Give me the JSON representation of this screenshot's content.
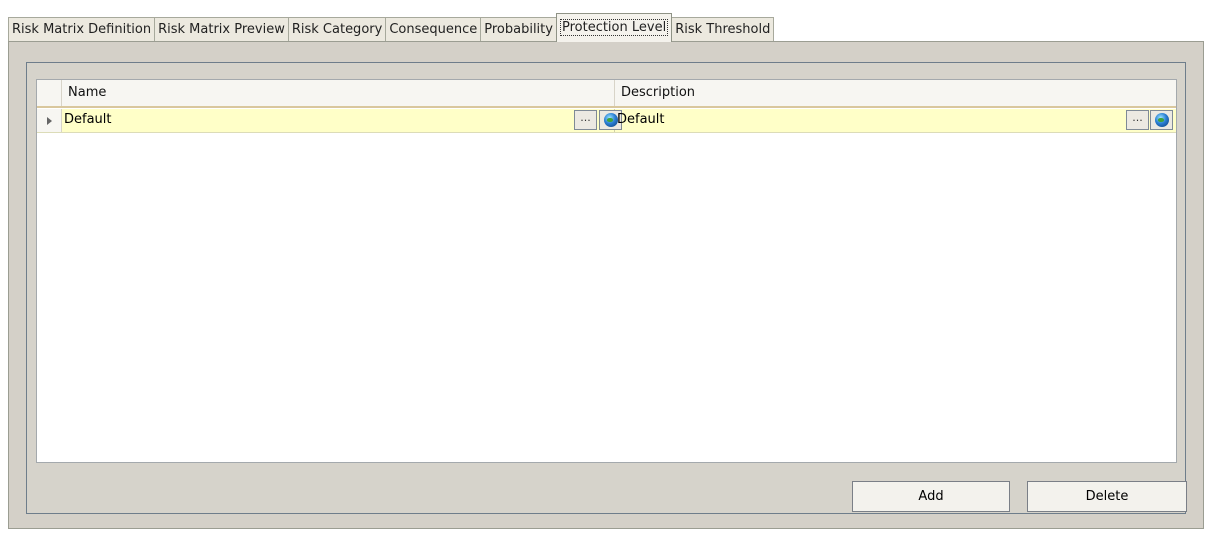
{
  "tabs": [
    {
      "label": "Risk Matrix Definition",
      "active": false
    },
    {
      "label": "Risk Matrix Preview",
      "active": false
    },
    {
      "label": "Risk Category",
      "active": false
    },
    {
      "label": "Consequence",
      "active": false
    },
    {
      "label": "Probability",
      "active": false
    },
    {
      "label": "Protection Level",
      "active": true
    },
    {
      "label": "Risk Threshold",
      "active": false
    }
  ],
  "grid": {
    "columns": [
      "Name",
      "Description"
    ],
    "rows": [
      {
        "name": "Default",
        "description": "Default"
      }
    ],
    "ellipsis_label": "···"
  },
  "buttons": {
    "add_label": "Add",
    "delete_label": "Delete"
  },
  "colors": {
    "selected_row": "#ffffc8",
    "panel": "#d4d0c8"
  }
}
